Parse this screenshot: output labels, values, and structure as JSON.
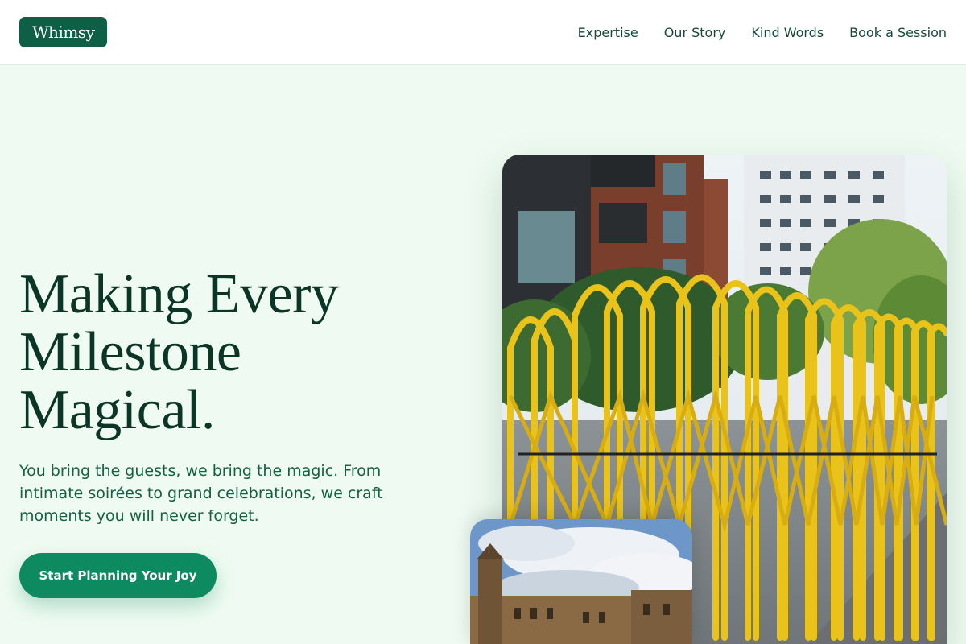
{
  "header": {
    "logo": "Whimsy",
    "nav": [
      "Expertise",
      "Our Story",
      "Kind Words",
      "Book a Session"
    ]
  },
  "hero": {
    "title_lines": [
      "Making Every",
      "Milestone",
      "Magical."
    ],
    "subtitle": "You bring the guests, we bring the magic. From intimate soirées to grand celebrations, we craft moments you will never forget.",
    "cta_label": "Start Planning Your Joy"
  },
  "images": {
    "main_alt": "Yellow folding barriers in front of city buildings",
    "secondary_alt": "Historic sandstone building under a cloudy sky"
  },
  "colors": {
    "brand": "#0d5f45",
    "accent": "#0d8a5f",
    "background": "#effbf2",
    "heading": "#0b3526"
  }
}
